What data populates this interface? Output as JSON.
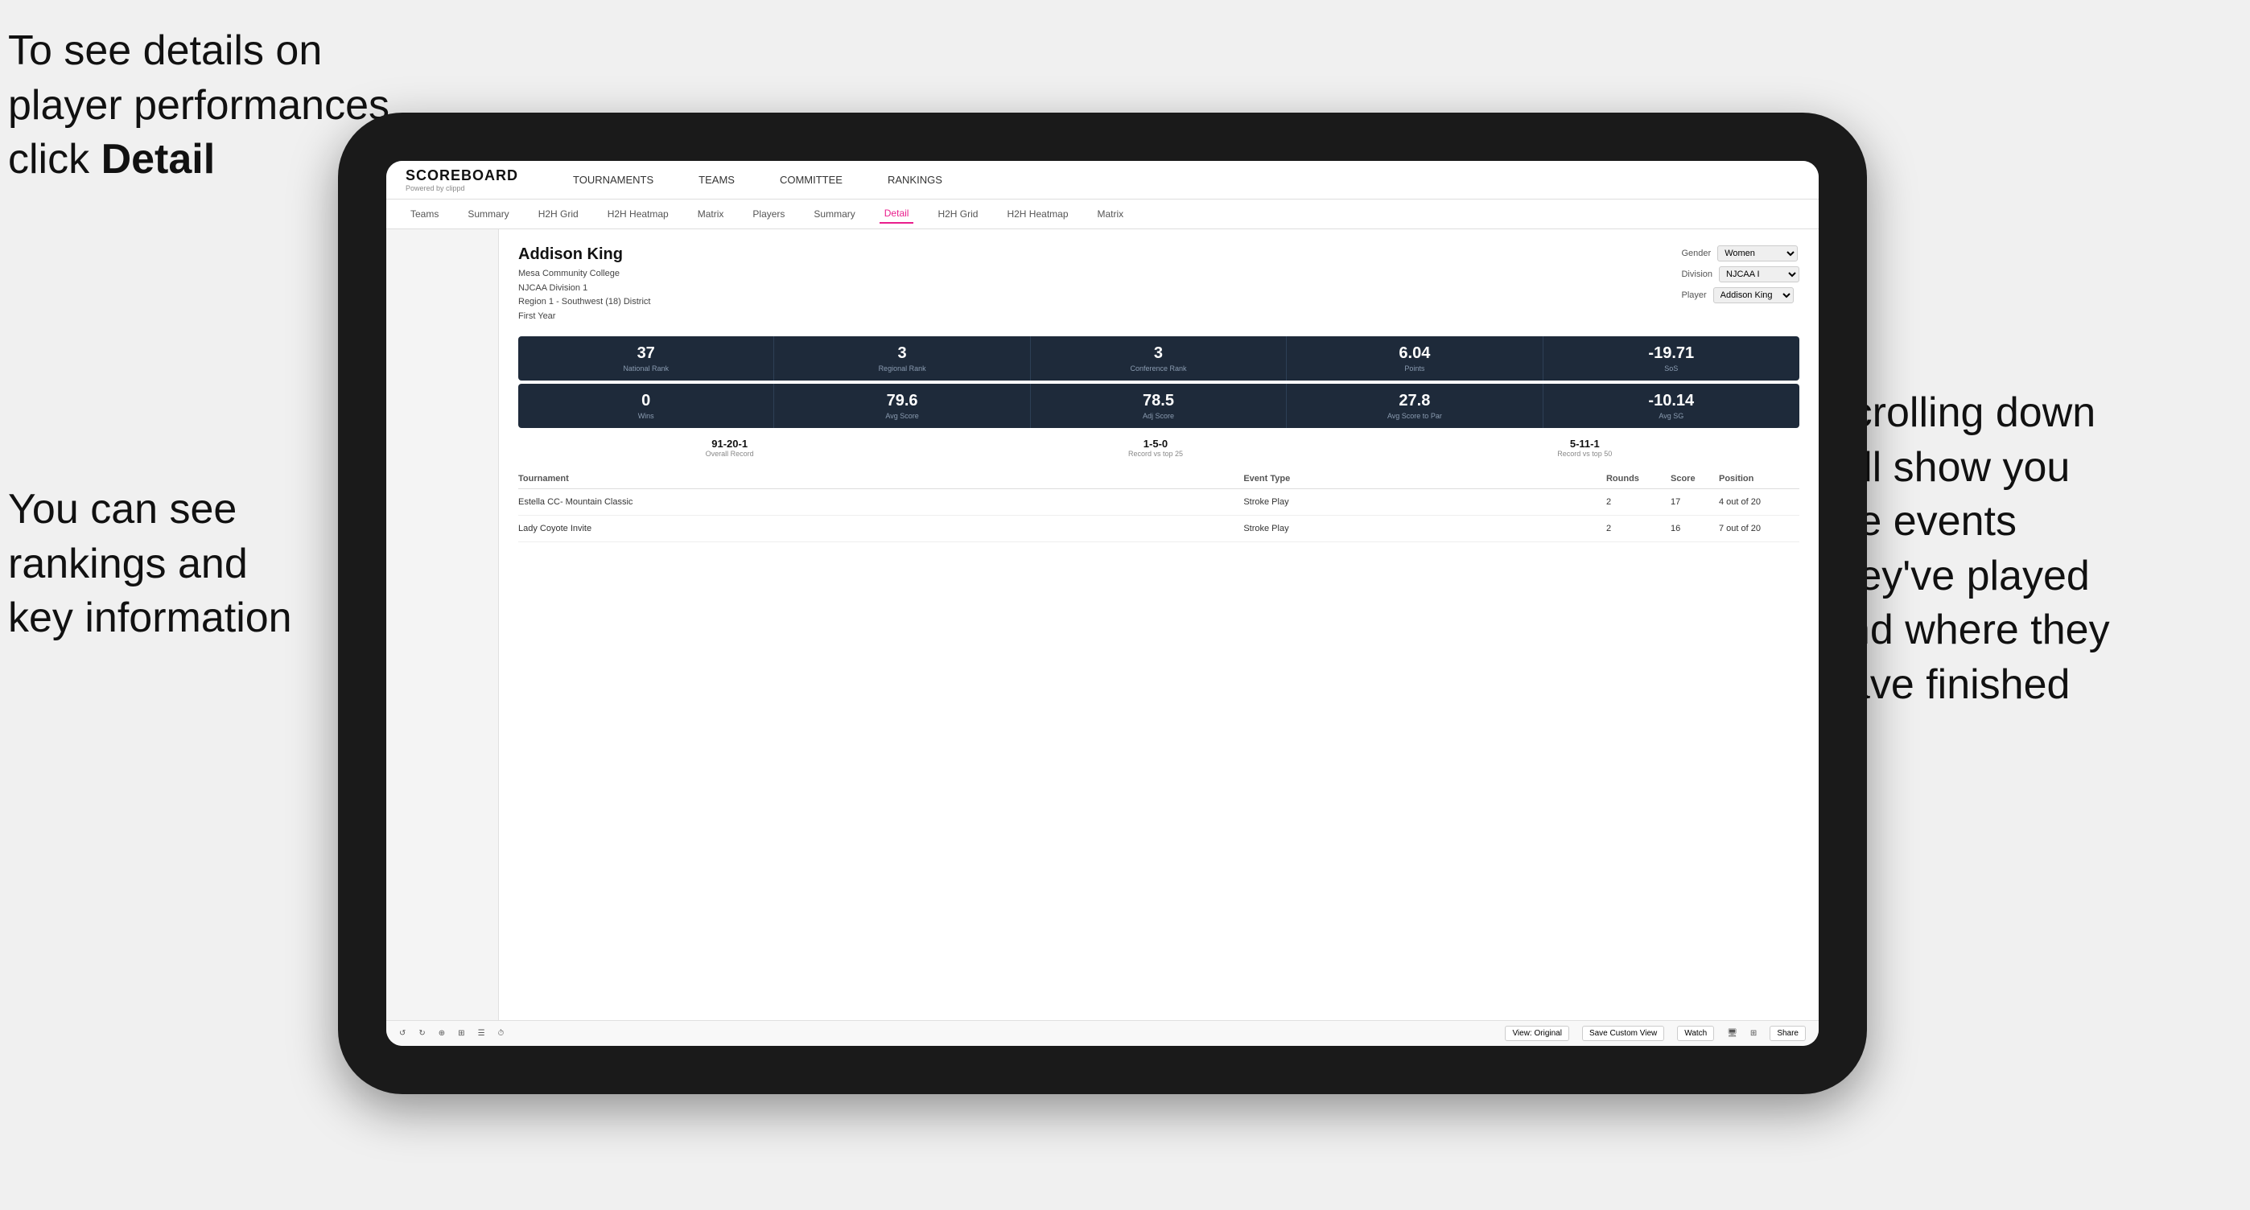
{
  "annotations": {
    "top_left_line1": "To see details on",
    "top_left_line2": "player performances",
    "top_left_line3": "click ",
    "top_left_bold": "Detail",
    "bottom_left_line1": "You can see",
    "bottom_left_line2": "rankings and",
    "bottom_left_line3": "key information",
    "right_line1": "Scrolling down",
    "right_line2": "will show you",
    "right_line3": "the events",
    "right_line4": "they've played",
    "right_line5": "and where they",
    "right_line6": "have finished"
  },
  "nav": {
    "logo": "SCOREBOARD",
    "logo_sub": "Powered by clippd",
    "items": [
      "TOURNAMENTS",
      "TEAMS",
      "COMMITTEE",
      "RANKINGS"
    ]
  },
  "sub_nav": {
    "items": [
      "Teams",
      "Summary",
      "H2H Grid",
      "H2H Heatmap",
      "Matrix",
      "Players",
      "Summary",
      "Detail",
      "H2H Grid",
      "H2H Heatmap",
      "Matrix"
    ],
    "active": "Detail"
  },
  "player": {
    "name": "Addison King",
    "college": "Mesa Community College",
    "division": "NJCAA Division 1",
    "region": "Region 1 - Southwest (18) District",
    "year": "First Year",
    "gender_label": "Gender",
    "gender_value": "Women",
    "division_label": "Division",
    "division_value": "NJCAA I",
    "player_label": "Player",
    "player_value": "Addison King"
  },
  "stats_row1": [
    {
      "value": "37",
      "label": "National Rank"
    },
    {
      "value": "3",
      "label": "Regional Rank"
    },
    {
      "value": "3",
      "label": "Conference Rank"
    },
    {
      "value": "6.04",
      "label": "Points"
    },
    {
      "value": "-19.71",
      "label": "SoS"
    }
  ],
  "stats_row2": [
    {
      "value": "0",
      "label": "Wins"
    },
    {
      "value": "79.6",
      "label": "Avg Score"
    },
    {
      "value": "78.5",
      "label": "Adj Score"
    },
    {
      "value": "27.8",
      "label": "Avg Score to Par"
    },
    {
      "value": "-10.14",
      "label": "Avg SG"
    }
  ],
  "records": [
    {
      "value": "91-20-1",
      "label": "Overall Record"
    },
    {
      "value": "1-5-0",
      "label": "Record vs top 25"
    },
    {
      "value": "5-11-1",
      "label": "Record vs top 50"
    }
  ],
  "table": {
    "headers": [
      "Tournament",
      "Event Type",
      "Rounds",
      "Score",
      "Position"
    ],
    "rows": [
      {
        "tournament": "Estella CC- Mountain Classic",
        "event_type": "Stroke Play",
        "rounds": "2",
        "score": "17",
        "position": "4 out of 20"
      },
      {
        "tournament": "Lady Coyote Invite",
        "event_type": "Stroke Play",
        "rounds": "2",
        "score": "16",
        "position": "7 out of 20"
      }
    ]
  },
  "toolbar": {
    "undo": "↺",
    "redo": "↻",
    "view_original": "View: Original",
    "save_custom": "Save Custom View",
    "watch": "Watch",
    "share": "Share"
  }
}
